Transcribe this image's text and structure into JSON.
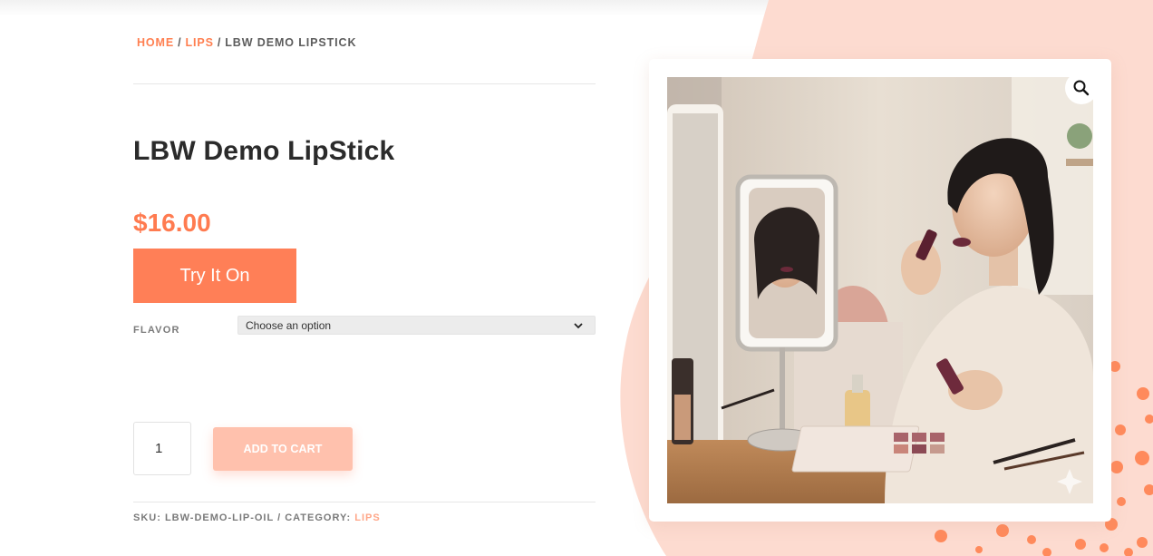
{
  "breadcrumb": {
    "home": "HOME",
    "separator": "/",
    "category": "LIPS",
    "current": "LBW DEMO LIPSTICK"
  },
  "product": {
    "title": "LBW Demo LipStick",
    "price": "$16.00",
    "try_on_label": "Try It On",
    "flavor_label": "FLAVOR",
    "flavor_selected": "Choose an option",
    "quantity": "1",
    "add_to_cart_label": "ADD TO CART",
    "sku_label": "SKU:",
    "sku_value": "LBW-DEMO-LIP-OIL",
    "meta_separator": "/",
    "category_label": "CATEGORY:",
    "category_value": "LIPS"
  },
  "gallery": {
    "zoom_icon": "magnifier-icon",
    "image_subject": "woman applying lipstick at vanity mirror"
  },
  "colors": {
    "accent": "#ff7f50",
    "button": "#ff7f57",
    "add_to_cart_disabled": "#ffc1ad",
    "background_blob": "#fddbd0",
    "dots": "#ff8a5c"
  }
}
